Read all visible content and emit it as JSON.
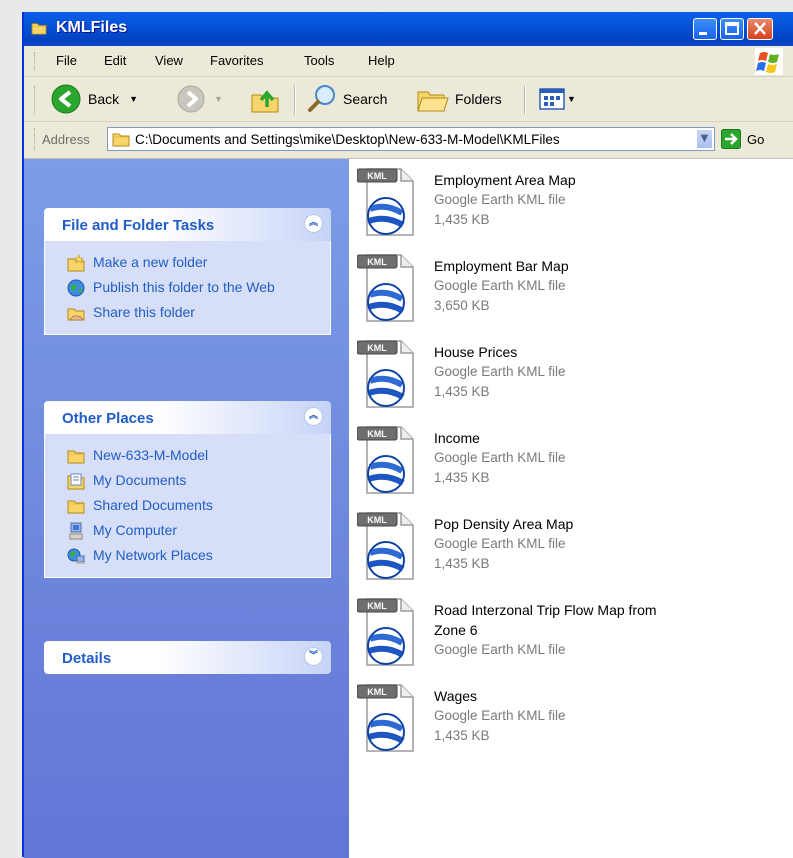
{
  "window": {
    "title": "KMLFiles",
    "title_bar_color": "#0553d6",
    "controls": [
      "minimize-icon",
      "maximize-icon",
      "close-icon"
    ]
  },
  "menu": {
    "items": [
      "File",
      "Edit",
      "View",
      "Favorites",
      "Tools",
      "Help"
    ]
  },
  "toolbar": {
    "back_label": "Back",
    "search_label": "Search",
    "folders_label": "Folders"
  },
  "address": {
    "label": "Address",
    "value": "C:\\Documents and Settings\\mike\\Desktop\\New-633-M-Model\\KMLFiles",
    "go_label": "Go"
  },
  "task_pane": {
    "file_tasks": {
      "title": "File and Folder Tasks",
      "items": [
        {
          "label": "Make a new folder",
          "icon": "new-folder-icon"
        },
        {
          "label": "Publish this folder to the Web",
          "icon": "publish-web-icon"
        },
        {
          "label": "Share this folder",
          "icon": "share-folder-icon"
        }
      ]
    },
    "other_places": {
      "title": "Other Places",
      "items": [
        {
          "label": "New-633-M-Model",
          "icon": "folder-icon"
        },
        {
          "label": "My Documents",
          "icon": "my-documents-icon"
        },
        {
          "label": "Shared Documents",
          "icon": "folder-icon"
        },
        {
          "label": "My Computer",
          "icon": "my-computer-icon"
        },
        {
          "label": "My Network Places",
          "icon": "network-places-icon"
        }
      ]
    },
    "details": {
      "title": "Details"
    }
  },
  "files": [
    {
      "name": "Employment Area Map",
      "type": "Google Earth KML file",
      "size": "1,435 KB"
    },
    {
      "name": "Employment Bar Map",
      "type": "Google Earth KML file",
      "size": "3,650 KB"
    },
    {
      "name": "House Prices",
      "type": "Google Earth KML file",
      "size": "1,435 KB"
    },
    {
      "name": "Income",
      "type": "Google Earth KML file",
      "size": "1,435 KB"
    },
    {
      "name": "Pop Density Area Map",
      "type": "Google Earth KML file",
      "size": "1,435 KB"
    },
    {
      "name": "Road Interzonal Trip Flow Map from Zone 6",
      "type": "Google Earth KML file",
      "size": ""
    },
    {
      "name": "Wages",
      "type": "Google Earth KML file",
      "size": "1,435 KB"
    }
  ],
  "file_icon_badge": "KML"
}
